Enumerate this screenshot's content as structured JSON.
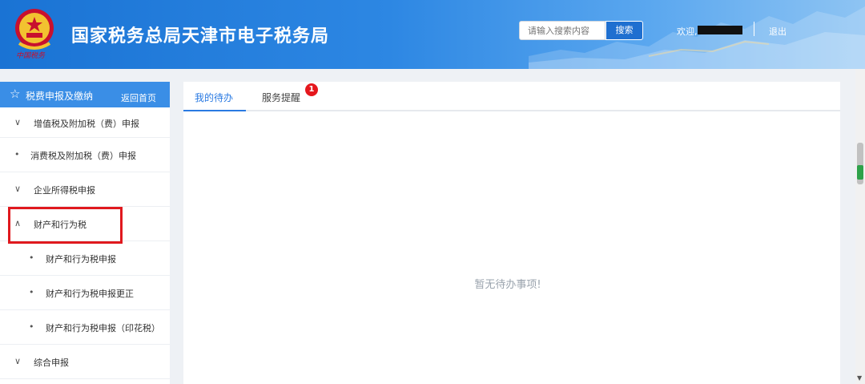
{
  "header": {
    "title": "国家税务总局天津市电子税务局",
    "motto": "中国税务",
    "search_placeholder": "请输入搜索内容",
    "search_button": "搜索",
    "welcome": "欢迎,",
    "logout": "退出"
  },
  "sidebar": {
    "title": "税费申报及缴纳",
    "home_link": "返回首页",
    "items": [
      {
        "mark": "∨",
        "label": "增值税及附加税（费）申报"
      },
      {
        "mark": "•",
        "label": "消费税及附加税（费）申报"
      },
      {
        "mark": "∨",
        "label": "企业所得税申报"
      },
      {
        "mark": "∧",
        "label": "财产和行为税"
      },
      {
        "mark": "•",
        "label": "财产和行为税申报"
      },
      {
        "mark": "•",
        "label": "财产和行为税申报更正"
      },
      {
        "mark": "•",
        "label": "财产和行为税申报（印花税）"
      },
      {
        "mark": "∨",
        "label": "综合申报"
      }
    ]
  },
  "main": {
    "tabs": [
      {
        "label": "我的待办",
        "active": true
      },
      {
        "label": "服务提醒",
        "active": false,
        "badge": "1"
      }
    ],
    "empty_text": "暂无待办事项!"
  },
  "colors": {
    "header_blue": "#1a73d4",
    "accent": "#2a7ae2",
    "sidebar_head": "#3a8ee6",
    "highlight_red": "#e0191e",
    "badge_red": "#e5171d"
  }
}
